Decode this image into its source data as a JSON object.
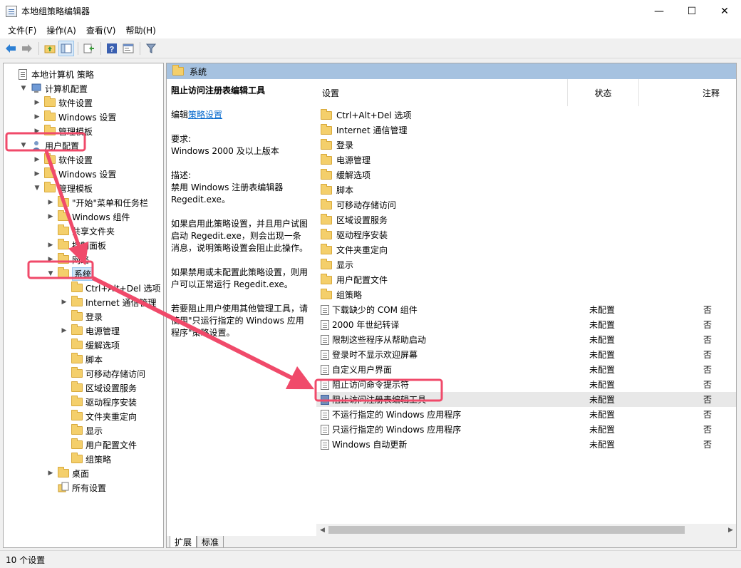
{
  "window": {
    "title": "本地组策略编辑器",
    "minimize": "—",
    "maximize": "☐",
    "close": "✕"
  },
  "menu": [
    "文件(F)",
    "操作(A)",
    "查看(V)",
    "帮助(H)"
  ],
  "toolbar": {
    "icons": [
      "back-arrow-icon",
      "forward-arrow-icon",
      "up-folder-icon",
      "show-hide-tree-icon",
      "export-list-icon",
      "help-icon",
      "properties-icon",
      "filter-icon"
    ]
  },
  "tree": [
    {
      "label": "本地计算机 策略",
      "level": 0,
      "expander": "",
      "icon": "doc"
    },
    {
      "label": "计算机配置",
      "level": 1,
      "expander": "v",
      "icon": "computer"
    },
    {
      "label": "软件设置",
      "level": 2,
      "expander": ">",
      "icon": "folder"
    },
    {
      "label": "Windows 设置",
      "level": 2,
      "expander": ">",
      "icon": "folder"
    },
    {
      "label": "管理模板",
      "level": 2,
      "expander": ">",
      "icon": "folder"
    },
    {
      "label": "用户配置",
      "level": 1,
      "expander": "v",
      "icon": "user"
    },
    {
      "label": "软件设置",
      "level": 2,
      "expander": ">",
      "icon": "folder"
    },
    {
      "label": "Windows 设置",
      "level": 2,
      "expander": ">",
      "icon": "folder"
    },
    {
      "label": "管理模板",
      "level": 2,
      "expander": "v",
      "icon": "folder"
    },
    {
      "label": "\"开始\"菜单和任务栏",
      "level": 3,
      "expander": ">",
      "icon": "folder"
    },
    {
      "label": "Windows 组件",
      "level": 3,
      "expander": ">",
      "icon": "folder"
    },
    {
      "label": "共享文件夹",
      "level": 3,
      "expander": "",
      "icon": "folder"
    },
    {
      "label": "控制面板",
      "level": 3,
      "expander": ">",
      "icon": "folder"
    },
    {
      "label": "网络",
      "level": 3,
      "expander": ">",
      "icon": "folder"
    },
    {
      "label": "系统",
      "level": 3,
      "expander": "v",
      "icon": "folder",
      "selected": true
    },
    {
      "label": "Ctrl+Alt+Del 选项",
      "level": 4,
      "expander": "",
      "icon": "folder"
    },
    {
      "label": "Internet 通信管理",
      "level": 4,
      "expander": ">",
      "icon": "folder"
    },
    {
      "label": "登录",
      "level": 4,
      "expander": "",
      "icon": "folder"
    },
    {
      "label": "电源管理",
      "level": 4,
      "expander": ">",
      "icon": "folder"
    },
    {
      "label": "缓解选项",
      "level": 4,
      "expander": "",
      "icon": "folder"
    },
    {
      "label": "脚本",
      "level": 4,
      "expander": "",
      "icon": "folder"
    },
    {
      "label": "可移动存储访问",
      "level": 4,
      "expander": "",
      "icon": "folder"
    },
    {
      "label": "区域设置服务",
      "level": 4,
      "expander": "",
      "icon": "folder"
    },
    {
      "label": "驱动程序安装",
      "level": 4,
      "expander": "",
      "icon": "folder"
    },
    {
      "label": "文件夹重定向",
      "level": 4,
      "expander": "",
      "icon": "folder"
    },
    {
      "label": "显示",
      "level": 4,
      "expander": "",
      "icon": "folder"
    },
    {
      "label": "用户配置文件",
      "level": 4,
      "expander": "",
      "icon": "folder"
    },
    {
      "label": "组策略",
      "level": 4,
      "expander": "",
      "icon": "folder"
    },
    {
      "label": "桌面",
      "level": 3,
      "expander": ">",
      "icon": "folder"
    },
    {
      "label": "所有设置",
      "level": 3,
      "expander": "",
      "icon": "allsettings"
    }
  ],
  "right_header": {
    "title": "系统"
  },
  "description": {
    "title": "阻止访问注册表编辑工具",
    "edit_prefix": "编辑",
    "edit_link": "策略设置",
    "requirements_label": "要求:",
    "requirements": "Windows 2000 及以上版本",
    "desc_label": "描述:",
    "desc_text": "禁用 Windows 注册表编辑器 Regedit.exe。",
    "para1": "如果启用此策略设置，并且用户试图启动 Regedit.exe，则会出现一条消息，说明策略设置会阻止此操作。",
    "para2": "如果禁用或未配置此策略设置，则用户可以正常运行 Regedit.exe。",
    "para3": "若要阻止用户使用其他管理工具，请使用\"只运行指定的 Windows 应用程序\"策略设置。"
  },
  "columns": {
    "setting": "设置",
    "state": "状态",
    "comment": "注释"
  },
  "list": [
    {
      "name": "Ctrl+Alt+Del 选项",
      "type": "folder",
      "state": "",
      "comment": ""
    },
    {
      "name": "Internet 通信管理",
      "type": "folder",
      "state": "",
      "comment": ""
    },
    {
      "name": "登录",
      "type": "folder",
      "state": "",
      "comment": ""
    },
    {
      "name": "电源管理",
      "type": "folder",
      "state": "",
      "comment": ""
    },
    {
      "name": "缓解选项",
      "type": "folder",
      "state": "",
      "comment": ""
    },
    {
      "name": "脚本",
      "type": "folder",
      "state": "",
      "comment": ""
    },
    {
      "name": "可移动存储访问",
      "type": "folder",
      "state": "",
      "comment": ""
    },
    {
      "name": "区域设置服务",
      "type": "folder",
      "state": "",
      "comment": ""
    },
    {
      "name": "驱动程序安装",
      "type": "folder",
      "state": "",
      "comment": ""
    },
    {
      "name": "文件夹重定向",
      "type": "folder",
      "state": "",
      "comment": ""
    },
    {
      "name": "显示",
      "type": "folder",
      "state": "",
      "comment": ""
    },
    {
      "name": "用户配置文件",
      "type": "folder",
      "state": "",
      "comment": ""
    },
    {
      "name": "组策略",
      "type": "folder",
      "state": "",
      "comment": ""
    },
    {
      "name": "下载缺少的 COM 组件",
      "type": "setting",
      "state": "未配置",
      "comment": "否"
    },
    {
      "name": "2000 年世纪转译",
      "type": "setting",
      "state": "未配置",
      "comment": "否"
    },
    {
      "name": "限制这些程序从帮助启动",
      "type": "setting",
      "state": "未配置",
      "comment": "否"
    },
    {
      "name": "登录时不显示欢迎屏幕",
      "type": "setting",
      "state": "未配置",
      "comment": "否"
    },
    {
      "name": "自定义用户界面",
      "type": "setting",
      "state": "未配置",
      "comment": "否"
    },
    {
      "name": "阻止访问命令提示符",
      "type": "setting",
      "state": "未配置",
      "comment": "否"
    },
    {
      "name": "阻止访问注册表编辑工具",
      "type": "setting",
      "state": "未配置",
      "comment": "否",
      "selected": true
    },
    {
      "name": "不运行指定的 Windows 应用程序",
      "type": "setting",
      "state": "未配置",
      "comment": "否"
    },
    {
      "name": "只运行指定的 Windows 应用程序",
      "type": "setting",
      "state": "未配置",
      "comment": "否"
    },
    {
      "name": "Windows 自动更新",
      "type": "setting",
      "state": "未配置",
      "comment": "否"
    }
  ],
  "bottom_tabs": [
    "扩展",
    "标准"
  ],
  "status": "10 个设置",
  "colors": {
    "annotation": "#f04a6a",
    "header": "#a6c2e0",
    "selection": "#cce4f7"
  }
}
